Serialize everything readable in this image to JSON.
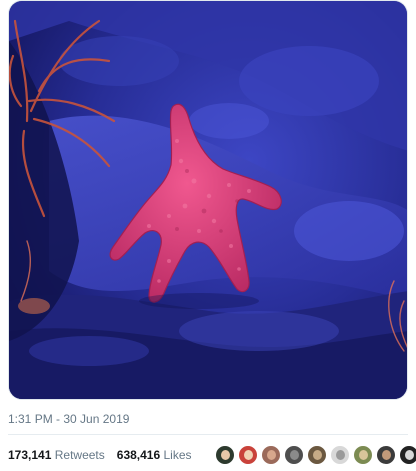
{
  "tweet": {
    "photo_icon": "starfish-photo",
    "timestamp": "1:31 PM - 30 Jun 2019",
    "retweets_count": "173,141",
    "retweets_label": "Retweets",
    "likes_count": "638,416",
    "likes_label": "Likes",
    "liker_avatars": [
      {
        "bg": "#2d3a2e",
        "face": "#e8c7a8"
      },
      {
        "bg": "#c9423a",
        "face": "#f1d2b3"
      },
      {
        "bg": "#9b6a5a",
        "face": "#d7a78c"
      },
      {
        "bg": "#4e4e4e",
        "face": "#8a8a8a"
      },
      {
        "bg": "#6b5840",
        "face": "#c7ab86"
      },
      {
        "bg": "#d8d8d8",
        "face": "#9a9a9a"
      },
      {
        "bg": "#7c8b52",
        "face": "#d9c59a"
      },
      {
        "bg": "#3b3b3b",
        "face": "#c29a7a"
      },
      {
        "bg": "#222222",
        "face": "#d8d8d8"
      }
    ]
  },
  "colors": {
    "water_dark": "#1b1f6e",
    "rock_light": "#5660d9",
    "starfish": "#e0447e",
    "muted_text": "#657786"
  }
}
